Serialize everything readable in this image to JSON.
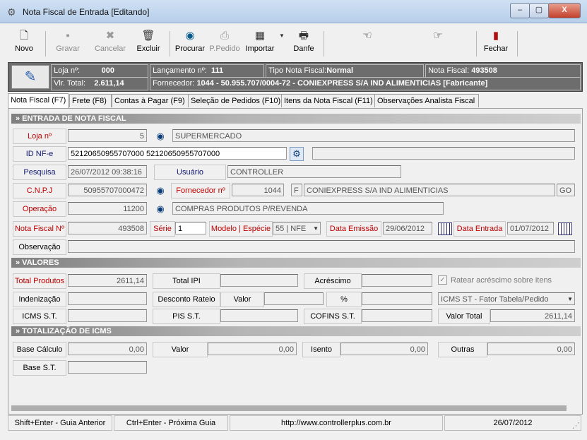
{
  "window": {
    "title": "Nota Fiscal de Entrada [Editando]",
    "min": "–",
    "max": "▢",
    "close": "X"
  },
  "toolbar": {
    "novo": "Novo",
    "gravar": "Gravar",
    "cancelar": "Cancelar",
    "excluir": "Excluir",
    "procurar": "Procurar",
    "ppedido": "P.Pedido",
    "importar": "Importar",
    "danfe": "Danfe",
    "fechar": "Fechar"
  },
  "header": {
    "loja_label": "Loja nº:",
    "loja_value": "000",
    "vlr_label": "Vlr. Total:",
    "vlr_value": "2.611,14",
    "lanc_label": "Lançamento nº:",
    "lanc_value": "111",
    "tipo_label": "Tipo Nota Fiscal:",
    "tipo_value": "Normal",
    "nota_label": "Nota Fiscal:",
    "nota_value": "493508",
    "forn_label": "Fornecedor:",
    "forn_value": "1044 - 50.955.707/0004-72 - CONIEXPRESS S/A IND ALIMENTICIAS [Fabricante]"
  },
  "tabs": [
    "Nota Fiscal (F7)",
    "Frete (F8)",
    "Contas à Pagar (F9)",
    "Seleção de Pedidos (F10)",
    "Itens da Nota Fiscal (F11)",
    "Observações Analista Fiscal"
  ],
  "entrada": {
    "section": "» ENTRADA DE NOTA FISCAL",
    "loja_label": "Loja nº",
    "loja_value": "5",
    "loja_name": "SUPERMERCADO",
    "idnfe_label": "ID NF-e",
    "idnfe_value": "52120650955707000 52120650955707000",
    "pesquisa_label": "Pesquisa",
    "pesquisa_value": "26/07/2012 09:38:16",
    "usuario_label": "Usuário",
    "usuario_value": "CONTROLLER",
    "cnpj_label": "C.N.P.J",
    "cnpj_value": "50955707000472",
    "fornecedor_label": "Fornecedor nº",
    "fornecedor_value": "1044",
    "fornecedor_tipo": "F",
    "fornecedor_name": "CONIEXPRESS S/A IND ALIMENTICIAS",
    "fornecedor_uf": "GO",
    "operacao_label": "Operação",
    "operacao_value": "11200",
    "operacao_name": "COMPRAS PRODUTOS P/REVENDA",
    "nf_label": "Nota Fiscal Nº",
    "nf_value": "493508",
    "serie_label": "Série",
    "serie_value": "1",
    "modelo_label": "Modelo | Espécie",
    "modelo_value": "55 | NFE",
    "emissao_label": "Data Emissão",
    "emissao_value": "29/06/2012",
    "entrada_label": "Data Entrada",
    "entrada_value": "01/07/2012",
    "obs_label": "Observação",
    "obs_value": ""
  },
  "valores": {
    "section": "» VALORES",
    "total_produtos_label": "Total Produtos",
    "total_produtos_value": "2611,14",
    "total_ipi_label": "Total IPI",
    "total_ipi_value": "",
    "acrescimo_label": "Acréscimo",
    "acrescimo_value": "",
    "ratear_label": "Ratear acréscimo sobre itens",
    "indenizacao_label": "Indenização",
    "indenizacao_value": "",
    "desconto_label": "Desconto Rateio",
    "valor_label": "Valor",
    "valor_value": "",
    "pct_label": "%",
    "pct_value": "",
    "icms_opt": "ICMS ST - Fator Tabela/Pedido",
    "icmsst_label": "ICMS S.T.",
    "icmsst_value": "",
    "pisst_label": "PIS S.T.",
    "pisst_value": "",
    "cofins_label": "COFINS S.T.",
    "cofins_value": "",
    "valor_total_label": "Valor Total",
    "valor_total_value": "2611,14"
  },
  "icms": {
    "section": "» TOTALIZAÇÃO DE ICMS",
    "base_label": "Base Cálculo",
    "base_value": "0,00",
    "valor_label": "Valor",
    "valor_value": "0,00",
    "isento_label": "Isento",
    "isento_value": "0,00",
    "outras_label": "Outras",
    "outras_value": "0,00",
    "basest_label": "Base S.T.",
    "basest_value": ""
  },
  "status": {
    "anterior": "Shift+Enter - Guia Anterior",
    "proxima": "Ctrl+Enter - Próxima Guia",
    "url": "http://www.controllerplus.com.br",
    "date": "26/07/2012"
  }
}
